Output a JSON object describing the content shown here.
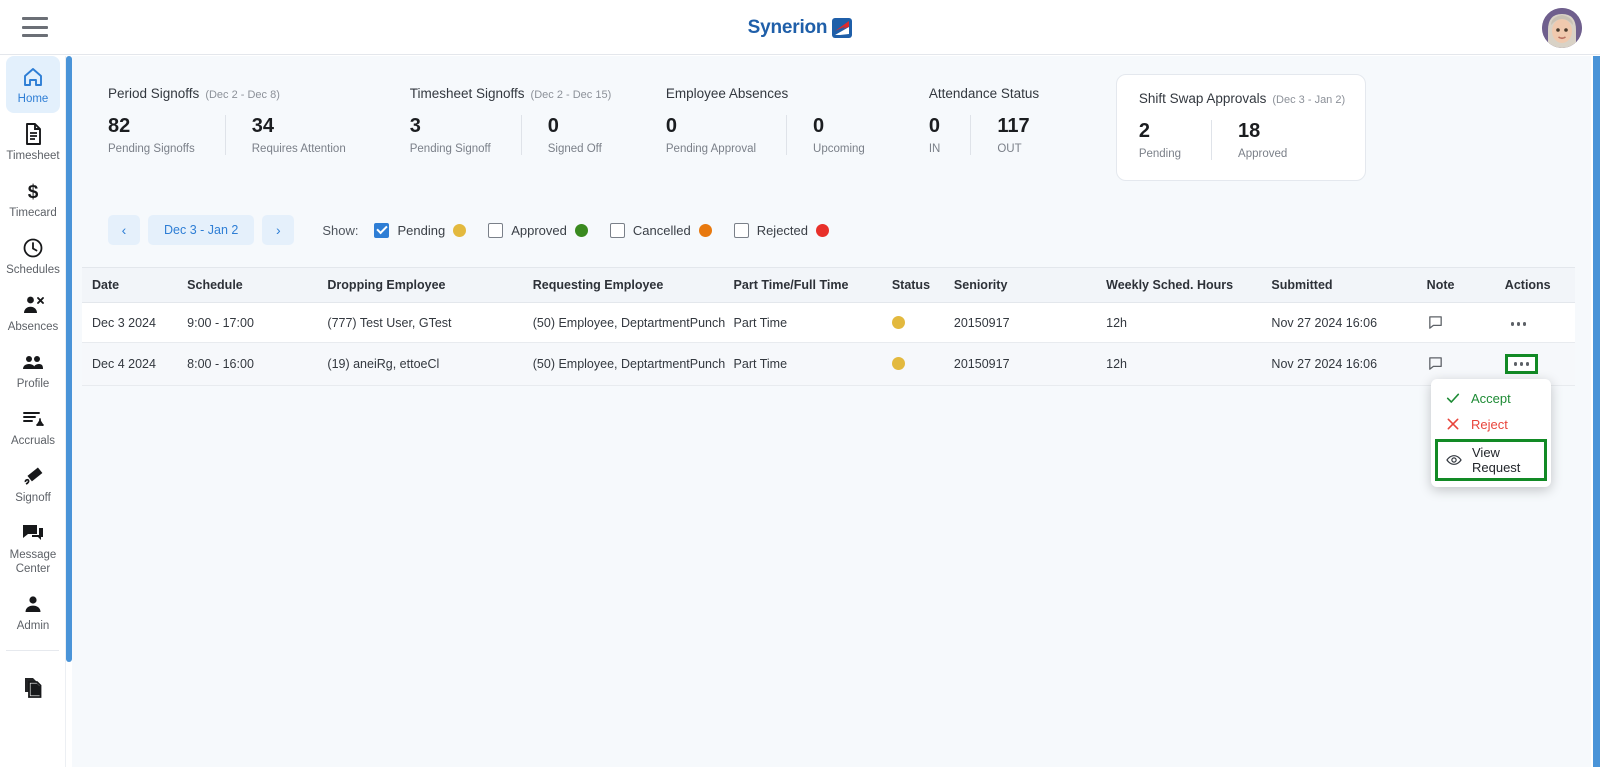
{
  "header": {
    "menu_icon": "hamburger-icon",
    "brand_name": "Synerion",
    "brand_mark": "synerion-arrow-logo",
    "avatar": "user-avatar"
  },
  "sidebar": {
    "items": [
      {
        "label": "Home",
        "icon": "home-icon",
        "active": true
      },
      {
        "label": "Timesheet",
        "icon": "document-icon",
        "active": false
      },
      {
        "label": "Timecard",
        "icon": "dollar-icon",
        "active": false
      },
      {
        "label": "Schedules",
        "icon": "clock-icon",
        "active": false
      },
      {
        "label": "Absences",
        "icon": "person-remove-icon",
        "active": false
      },
      {
        "label": "Profile",
        "icon": "people-icon",
        "active": false
      },
      {
        "label": "Accruals",
        "icon": "list-balance-icon",
        "active": false
      },
      {
        "label": "Signoff",
        "icon": "signature-icon",
        "active": false
      },
      {
        "label": "Message Center",
        "icon": "chat-icon",
        "active": false
      },
      {
        "label": "Admin",
        "icon": "person-icon",
        "active": false
      }
    ],
    "footer_item": {
      "label": "",
      "icon": "copy-documents-icon"
    }
  },
  "kpis": [
    {
      "title": "Period Signoffs",
      "range": "(Dec 2 - Dec 8)",
      "selected": false,
      "stats": [
        {
          "value": "82",
          "label": "Pending Signoffs"
        },
        {
          "value": "34",
          "label": "Requires Attention"
        }
      ]
    },
    {
      "title": "Timesheet Signoffs",
      "range": "(Dec 2 - Dec 15)",
      "selected": false,
      "stats": [
        {
          "value": "3",
          "label": "Pending Signoff"
        },
        {
          "value": "0",
          "label": "Signed Off"
        }
      ]
    },
    {
      "title": "Employee Absences",
      "range": "",
      "selected": false,
      "stats": [
        {
          "value": "0",
          "label": "Pending Approval"
        },
        {
          "value": "0",
          "label": "Upcoming"
        }
      ]
    },
    {
      "title": "Attendance Status",
      "range": "",
      "selected": false,
      "stats": [
        {
          "value": "0",
          "label": "IN"
        },
        {
          "value": "117",
          "label": "OUT"
        }
      ]
    },
    {
      "title": "Shift Swap Approvals",
      "range": "(Dec 3 - Jan 2)",
      "selected": true,
      "stats": [
        {
          "value": "2",
          "label": "Pending"
        },
        {
          "value": "18",
          "label": "Approved"
        }
      ]
    }
  ],
  "filters": {
    "prev_label": "‹",
    "next_label": "›",
    "date_range": "Dec 3 - Jan 2",
    "show_label": "Show:",
    "options": [
      {
        "label": "Pending",
        "checked": true,
        "color": "#e3b93e"
      },
      {
        "label": "Approved",
        "checked": false,
        "color": "#3a8a1f"
      },
      {
        "label": "Cancelled",
        "checked": false,
        "color": "#e8790f"
      },
      {
        "label": "Rejected",
        "checked": false,
        "color": "#e8302a"
      }
    ]
  },
  "table": {
    "columns": [
      "Date",
      "Schedule",
      "Dropping Employee",
      "Requesting Employee",
      "Part Time/Full Time",
      "Status",
      "Seniority",
      "Weekly Sched. Hours",
      "Submitted",
      "Note",
      "Actions"
    ],
    "rows": [
      {
        "date": "Dec 3 2024",
        "schedule": "9:00 - 17:00",
        "dropping_employee": "(777) Test User, GTest",
        "requesting_employee": "(50) Employee, DeptartmentPunch",
        "part_full_time": "Part Time",
        "status_color": "#e3b93e",
        "seniority": "20150917",
        "weekly_sched_hours": "12h",
        "submitted": "Nov 27 2024 16:06",
        "note_icon": "comment-icon",
        "actions_icon": "kebab-menu-icon",
        "actions_highlighted": false
      },
      {
        "date": "Dec 4 2024",
        "schedule": "8:00 - 16:00",
        "dropping_employee": "(19) aneiRg, ettoeCl",
        "requesting_employee": "(50) Employee, DeptartmentPunch",
        "part_full_time": "Part Time",
        "status_color": "#e3b93e",
        "seniority": "20150917",
        "weekly_sched_hours": "12h",
        "submitted": "Nov 27 2024 16:06",
        "note_icon": "comment-icon",
        "actions_icon": "kebab-menu-icon",
        "actions_highlighted": true
      }
    ]
  },
  "context_menu": {
    "items": [
      {
        "label": "Accept",
        "icon": "check-icon",
        "highlighted": false
      },
      {
        "label": "Reject",
        "icon": "x-icon",
        "highlighted": false
      },
      {
        "label": "View Request",
        "icon": "eye-icon",
        "highlighted": true
      }
    ]
  },
  "colors": {
    "accent": "#2e7ed5",
    "brand": "#1f5fa9",
    "highlight_box": "#128a25",
    "pending": "#e3b93e",
    "approved": "#3a8a1f",
    "cancelled": "#e8790f",
    "rejected": "#e8302a"
  }
}
